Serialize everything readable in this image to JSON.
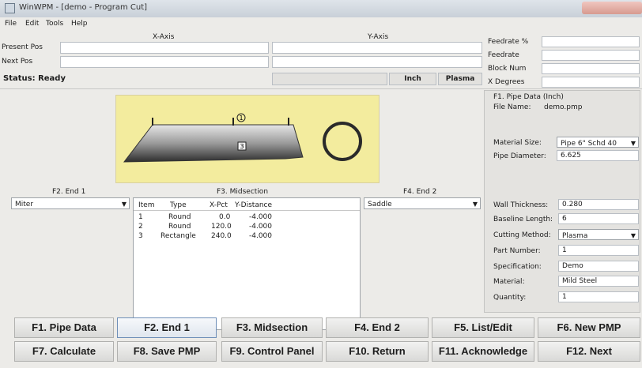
{
  "window": {
    "title": "WinWPM - [demo - Program Cut]"
  },
  "menu": [
    "File",
    "Edit",
    "Tools",
    "Help"
  ],
  "axes": {
    "x_label": "X-Axis",
    "y_label": "Y-Axis"
  },
  "position": {
    "present_label": "Present Pos",
    "next_label": "Next Pos"
  },
  "right_info": {
    "feedrate_pct": "Feedrate %",
    "feedrate": "Feedrate",
    "block_num": "Block Num",
    "degrees": "X Degrees"
  },
  "status": {
    "text": "Status: Ready",
    "unit": "Inch",
    "method": "Plasma"
  },
  "pipe_drawing": {
    "callout_1": "1",
    "callout_3": "3"
  },
  "end1": {
    "title": "F2. End 1",
    "value": "Miter"
  },
  "midsection": {
    "title": "F3. Midsection",
    "headers": [
      "Item",
      "Type",
      "X-Pct",
      "Y-Distance"
    ],
    "rows": [
      [
        "1",
        "Round",
        "0.0",
        "-4.000"
      ],
      [
        "2",
        "Round",
        "120.0",
        "-4.000"
      ],
      [
        "3",
        "Rectangle",
        "240.0",
        "-4.000"
      ]
    ]
  },
  "end2": {
    "title": "F4. End 2",
    "value": "Saddle"
  },
  "pipe_data": {
    "title": "F1. Pipe Data (Inch)",
    "file_name_label": "File Name:",
    "file_name": "demo.pmp",
    "material_size_label": "Material Size:",
    "material_size": "Pipe 6\" Schd 40",
    "pipe_diameter_label": "Pipe Diameter:",
    "pipe_diameter": "6.625",
    "wall_thickness_label": "Wall Thickness:",
    "wall_thickness": "0.280",
    "baseline_length_label": "Baseline Length:",
    "baseline_length": "6",
    "cutting_method_label": "Cutting Method:",
    "cutting_method": "Plasma",
    "part_number_label": "Part Number:",
    "part_number": "1",
    "specification_label": "Specification:",
    "specification": "Demo",
    "material_label": "Material:",
    "material": "Mild Steel",
    "quantity_label": "Quantity:",
    "quantity": "1"
  },
  "fkeys": {
    "f1": "F1. Pipe Data",
    "f2": "F2. End 1",
    "f3": "F3. Midsection",
    "f4": "F4. End 2",
    "f5": "F5. List/Edit",
    "f6": "F6. New PMP",
    "f7": "F7. Calculate",
    "f8": "F8. Save PMP",
    "f9": "F9. Control Panel",
    "f10": "F10. Return",
    "f11": "F11. Acknowledge",
    "f12": "F12. Next"
  },
  "icons": [
    "app-icon",
    "chevron-down-icon"
  ],
  "colors": {
    "drawing_bg": "#f3ec9e",
    "active_button_border": "#6f8fb8"
  }
}
